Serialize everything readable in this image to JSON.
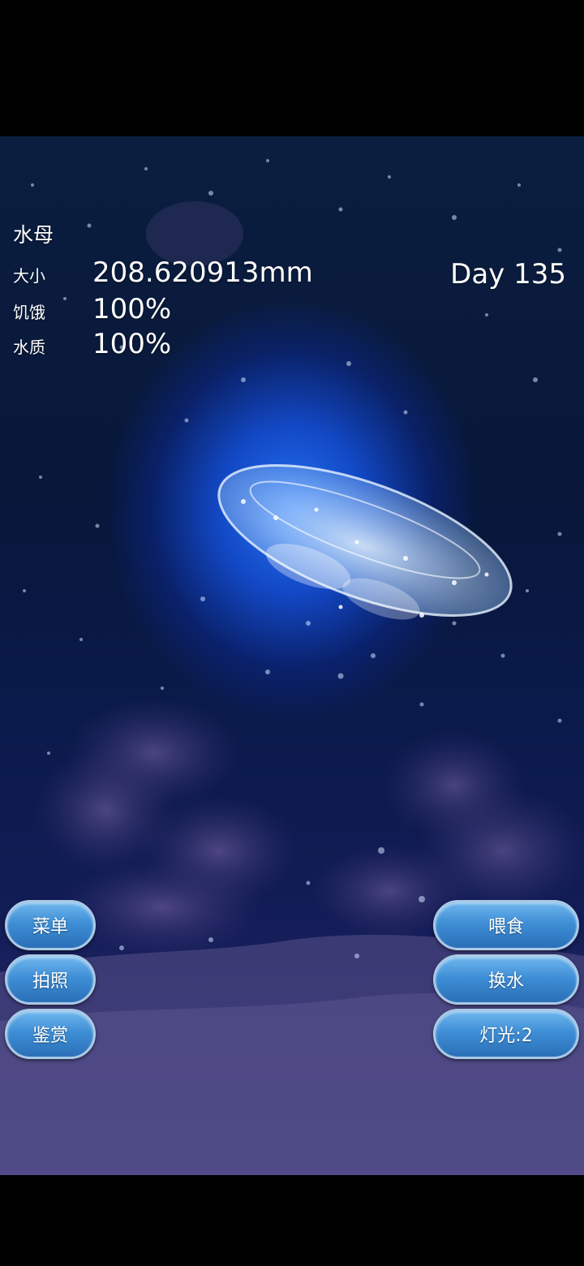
{
  "hud": {
    "title": "水母",
    "size_label": "大小",
    "size_value": "208.620913mm",
    "hunger_label": "饥饿",
    "hunger_value": "100%",
    "water_label": "水质",
    "water_value": "100%",
    "day": "Day 135"
  },
  "left_buttons": {
    "menu": "菜单",
    "photo": "拍照",
    "gallery": "鉴赏"
  },
  "right_buttons": {
    "feed": "喂食",
    "change_water": "换水",
    "light": "灯光:2"
  },
  "colors": {
    "button_fill": "#3f8fd6",
    "button_border": "#a9c9e6",
    "water_glow": "#2878ff"
  }
}
